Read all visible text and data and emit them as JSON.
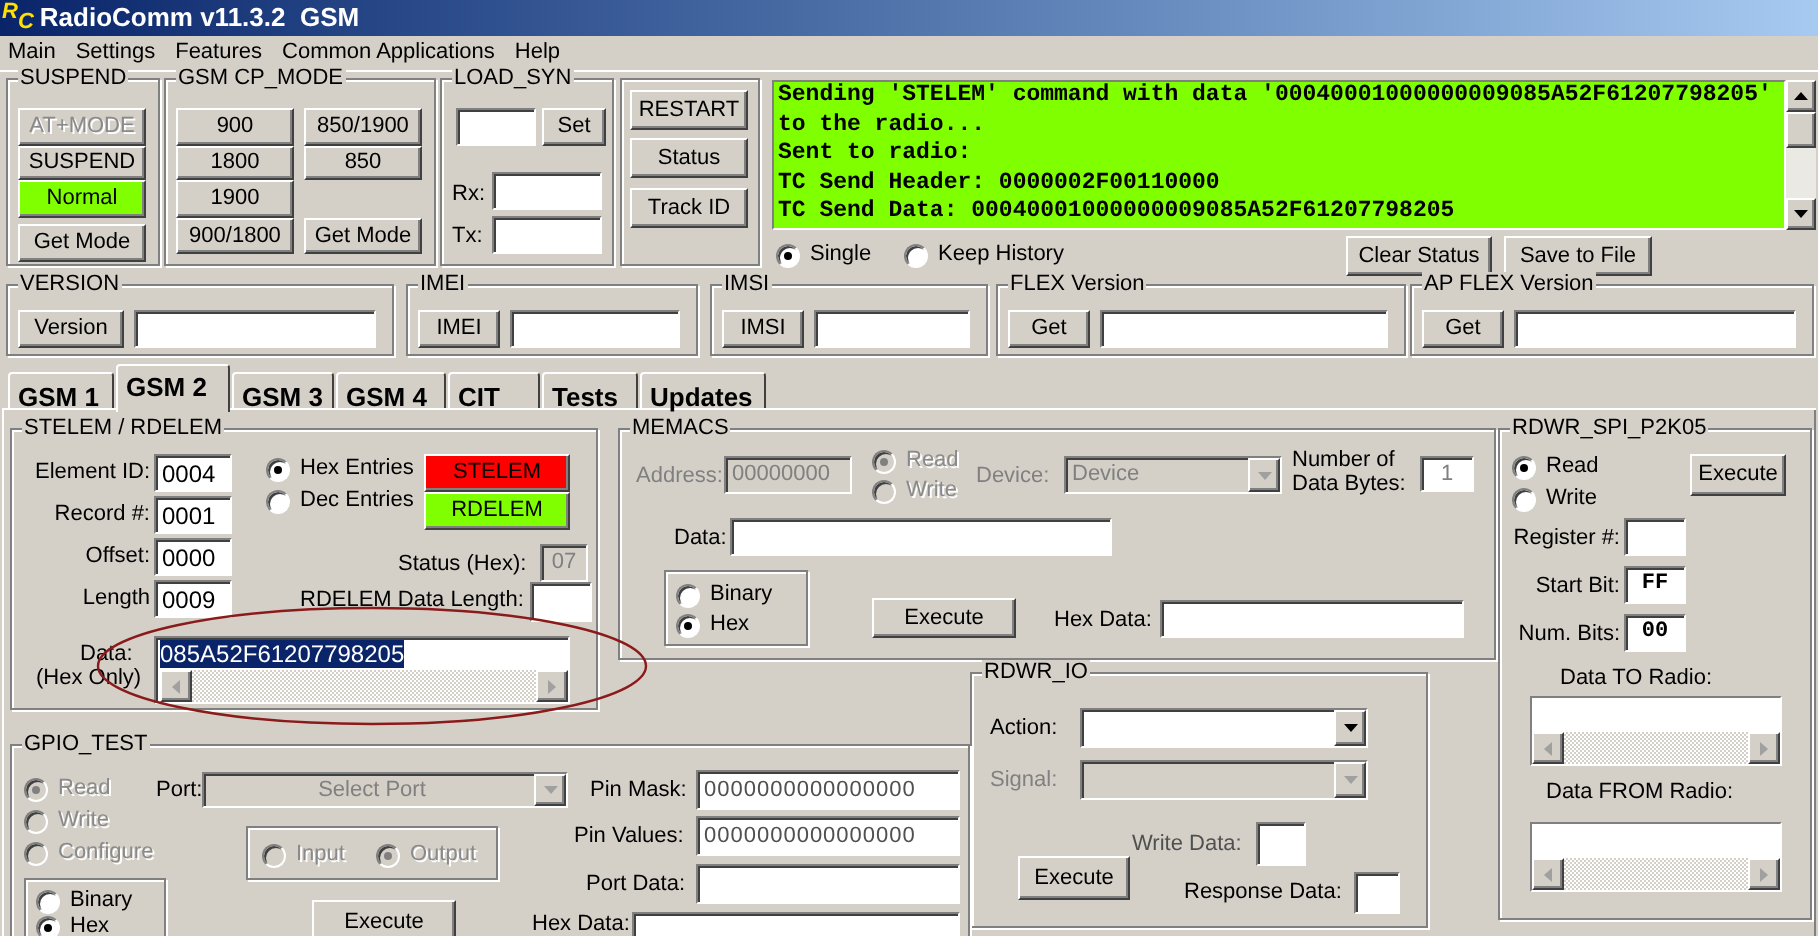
{
  "window": {
    "title": "RadioComm v11.3.2  GSM",
    "logo": [
      "R",
      "C"
    ]
  },
  "menu": [
    "Main",
    "Settings",
    "Features",
    "Common Applications",
    "Help"
  ],
  "suspend": {
    "title": "SUSPEND",
    "buttons": [
      {
        "label": "AT+MODE",
        "disabled": true
      },
      {
        "label": "SUSPEND",
        "disabled": false
      },
      {
        "label": "Normal",
        "disabled": false,
        "color": "#80ff00"
      },
      {
        "label": "Get Mode",
        "disabled": false
      }
    ]
  },
  "cp_mode": {
    "title": "GSM CP_MODE",
    "buttons": [
      "900",
      "850/1900",
      "1800",
      "850",
      "1900",
      "900/1800",
      "Get Mode"
    ]
  },
  "load_syn": {
    "title": "LOAD_SYN",
    "set_button": "Set",
    "rx_label": "Rx:",
    "tx_label": "Tx:"
  },
  "control_buttons": [
    "RESTART",
    "Status",
    "Track ID"
  ],
  "console": {
    "lines": [
      "Sending 'STELEM' command with data '00040001000000009085A52F61207798205'",
      "to the radio...",
      "Sent to radio:",
      "TC Send Header: 0000002F00110000",
      "TC Send Data: 00040001000000009085A52F61207798205"
    ],
    "options": [
      {
        "label": "Single",
        "selected": true
      },
      {
        "label": "Keep History",
        "selected": false
      }
    ],
    "buttons": [
      "Clear Status",
      "Save to File"
    ]
  },
  "info_groups": [
    {
      "title": "VERSION",
      "button": "Version"
    },
    {
      "title": "IMEI",
      "button": "IMEI"
    },
    {
      "title": "IMSI",
      "button": "IMSI"
    },
    {
      "title": "FLEX Version",
      "button": "Get"
    },
    {
      "title": "AP FLEX Version",
      "button": "Get"
    }
  ],
  "tabs": [
    {
      "label": "GSM 1",
      "selected": false
    },
    {
      "label": "GSM 2",
      "selected": true
    },
    {
      "label": "GSM 3",
      "selected": false
    },
    {
      "label": "GSM 4",
      "selected": false
    },
    {
      "label": "CIT",
      "selected": false
    },
    {
      "label": "Tests",
      "selected": false
    },
    {
      "label": "Updates",
      "selected": false
    }
  ],
  "stelem": {
    "title": "STELEM / RDELEM",
    "fields": [
      {
        "label": "Element ID:",
        "value": "0004"
      },
      {
        "label": "Record #:",
        "value": "0001"
      },
      {
        "label": "Offset:",
        "value": "0000"
      },
      {
        "label": "Length",
        "value": "0009"
      }
    ],
    "entry_mode": [
      {
        "label": "Hex Entries",
        "selected": true
      },
      {
        "label": "Dec Entries",
        "selected": false
      }
    ],
    "buttons": [
      {
        "label": "STELEM",
        "color": "#ff0000"
      },
      {
        "label": "RDELEM",
        "color": "#80ff00"
      }
    ],
    "status": {
      "label": "Status (Hex):",
      "value": "07",
      "disabled": true
    },
    "length_label": "RDELEM Data Length:",
    "data_label": "Data:",
    "data_note": "(Hex Only)",
    "data_value": "085A52F61207798205"
  },
  "memacs": {
    "title": "MEMACS",
    "address": {
      "label": "Address:",
      "value": "00000000",
      "disabled": true
    },
    "access": [
      {
        "label": "Read",
        "selected": true,
        "disabled": true
      },
      {
        "label": "Write",
        "selected": false,
        "disabled": true
      }
    ],
    "device": {
      "label": "Device:",
      "value": "Device",
      "disabled": true
    },
    "bytes_label": "Number of Data Bytes:",
    "bytes_value": "1",
    "data_label": "Data:",
    "format": [
      {
        "label": "Binary",
        "selected": false
      },
      {
        "label": "Hex",
        "selected": true
      }
    ],
    "execute": "Execute",
    "hex_data_label": "Hex Data:"
  },
  "spi": {
    "title": "RDWR_SPI_P2K05",
    "mode": [
      {
        "label": "Read",
        "selected": true
      },
      {
        "label": "Write",
        "selected": false
      }
    ],
    "execute": "Execute",
    "fields": [
      {
        "label": "Register #:"
      },
      {
        "label": "Start Bit:",
        "value": "FF"
      },
      {
        "label": "Num. Bits:",
        "value": "00"
      }
    ],
    "to_label": "Data TO Radio:",
    "from_label": "Data FROM Radio:"
  },
  "rdwr_io": {
    "title": "RDWR_IO",
    "action": {
      "label": "Action:",
      "disabled": false
    },
    "signal": {
      "label": "Signal:",
      "disabled": true
    },
    "write_label": "Write Data:",
    "execute": "Execute",
    "response_label": "Response Data:"
  },
  "gpio": {
    "title": "GPIO_TEST",
    "mode": [
      {
        "label": "Read",
        "selected": true,
        "disabled": true
      },
      {
        "label": "Write",
        "selected": false,
        "disabled": true
      },
      {
        "label": "Configure",
        "selected": false,
        "disabled": true
      }
    ],
    "port": {
      "label": "Port:",
      "value": "Select Port",
      "disabled": true
    },
    "pin_mask": {
      "label": "Pin Mask:",
      "value": "0000000000000000"
    },
    "pin_values": {
      "label": "Pin Values:",
      "value": "0000000000000000"
    },
    "port_data_label": "Port Data:",
    "direction": [
      {
        "label": "Input",
        "selected": false,
        "disabled": true
      },
      {
        "label": "Output",
        "selected": true,
        "disabled": true
      }
    ],
    "format": [
      {
        "label": "Binary",
        "selected": false
      },
      {
        "label": "Hex",
        "selected": true
      }
    ],
    "execute": "Execute",
    "hex_data_label": "Hex Data:"
  }
}
